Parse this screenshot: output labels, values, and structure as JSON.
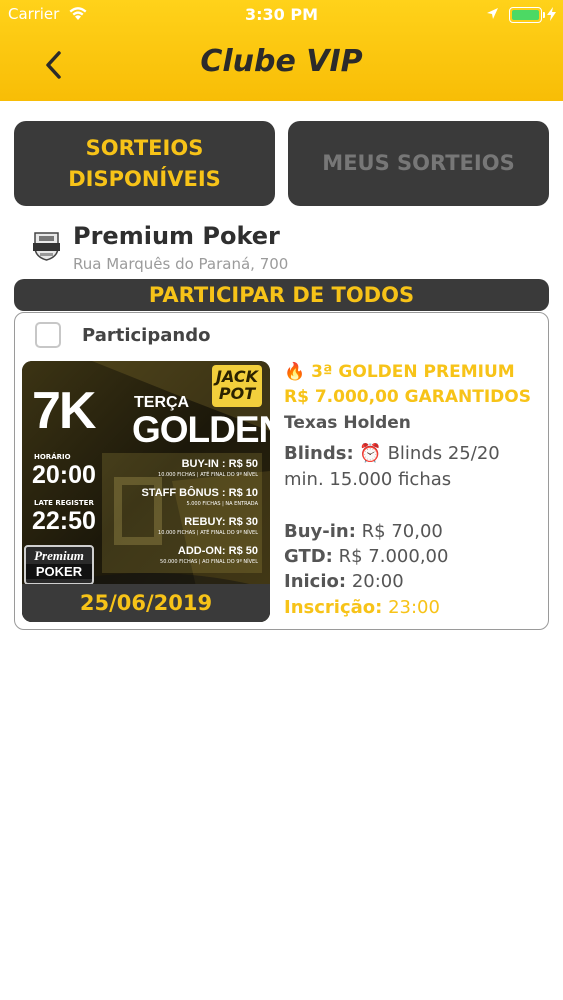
{
  "status_bar": {
    "carrier": "Carrier",
    "time": "3:30 PM"
  },
  "nav": {
    "title": "Clube VIP"
  },
  "tabs": {
    "available": "SORTEIOS DISPONÍVEIS",
    "mine": "MEUS SORTEIOS"
  },
  "club": {
    "name": "Premium Poker",
    "address": "Rua Marquês do Paraná, 700"
  },
  "join_all_label": "PARTICIPAR DE TODOS",
  "event": {
    "participating_label": "Participando",
    "participating_checked": false,
    "title_emoji": "🔥",
    "title": "3ª GOLDEN PREMIUM R$ 7.000,00 GARANTIDOS",
    "variant": "Texas Holden",
    "blinds_label": "Blinds:",
    "blinds_emoji": "⏰",
    "blinds_value": "Blinds 25/20 min. 15.000 fichas",
    "buyin_label": "Buy-in:",
    "buyin_value": "R$ 70,00",
    "gtd_label": "GTD:",
    "gtd_value": "R$ 7.000,00",
    "start_label": "Inicio:",
    "start_value": "20:00",
    "registration_label": "Inscrição:",
    "registration_value": "23:00",
    "date": "25/06/2019",
    "poster": {
      "big_value": "7K",
      "day": "TERÇA",
      "name": "GOLDEN",
      "jackpot_1": "JACK",
      "jackpot_2": "POT",
      "horario_label": "HORÁRIO",
      "horario": "20:00",
      "late_label": "LATE REGISTER",
      "late": "22:50",
      "buyin": "BUY-IN : R$ 50",
      "buyin_sub": "10.000 FICHAS | ATÉ FINAL DO 9º NÍVEL",
      "staff": "STAFF BÔNUS : R$ 10",
      "staff_sub": "5.000 FICHAS | NA ENTRADA",
      "rebuy": "REBUY: R$ 30",
      "rebuy_sub": "10.000 FICHAS | ATÉ FINAL DO 9º NÍVEL",
      "addon": "ADD-ON: R$ 50",
      "addon_sub": "50.000 FICHAS | AO FINAL DO 9º NÍVEL",
      "logo_1": "Premium",
      "logo_2": "POKER"
    }
  },
  "colors": {
    "accent": "#f7c318",
    "dark": "#3a3a3a",
    "header": "#fcc60e"
  }
}
